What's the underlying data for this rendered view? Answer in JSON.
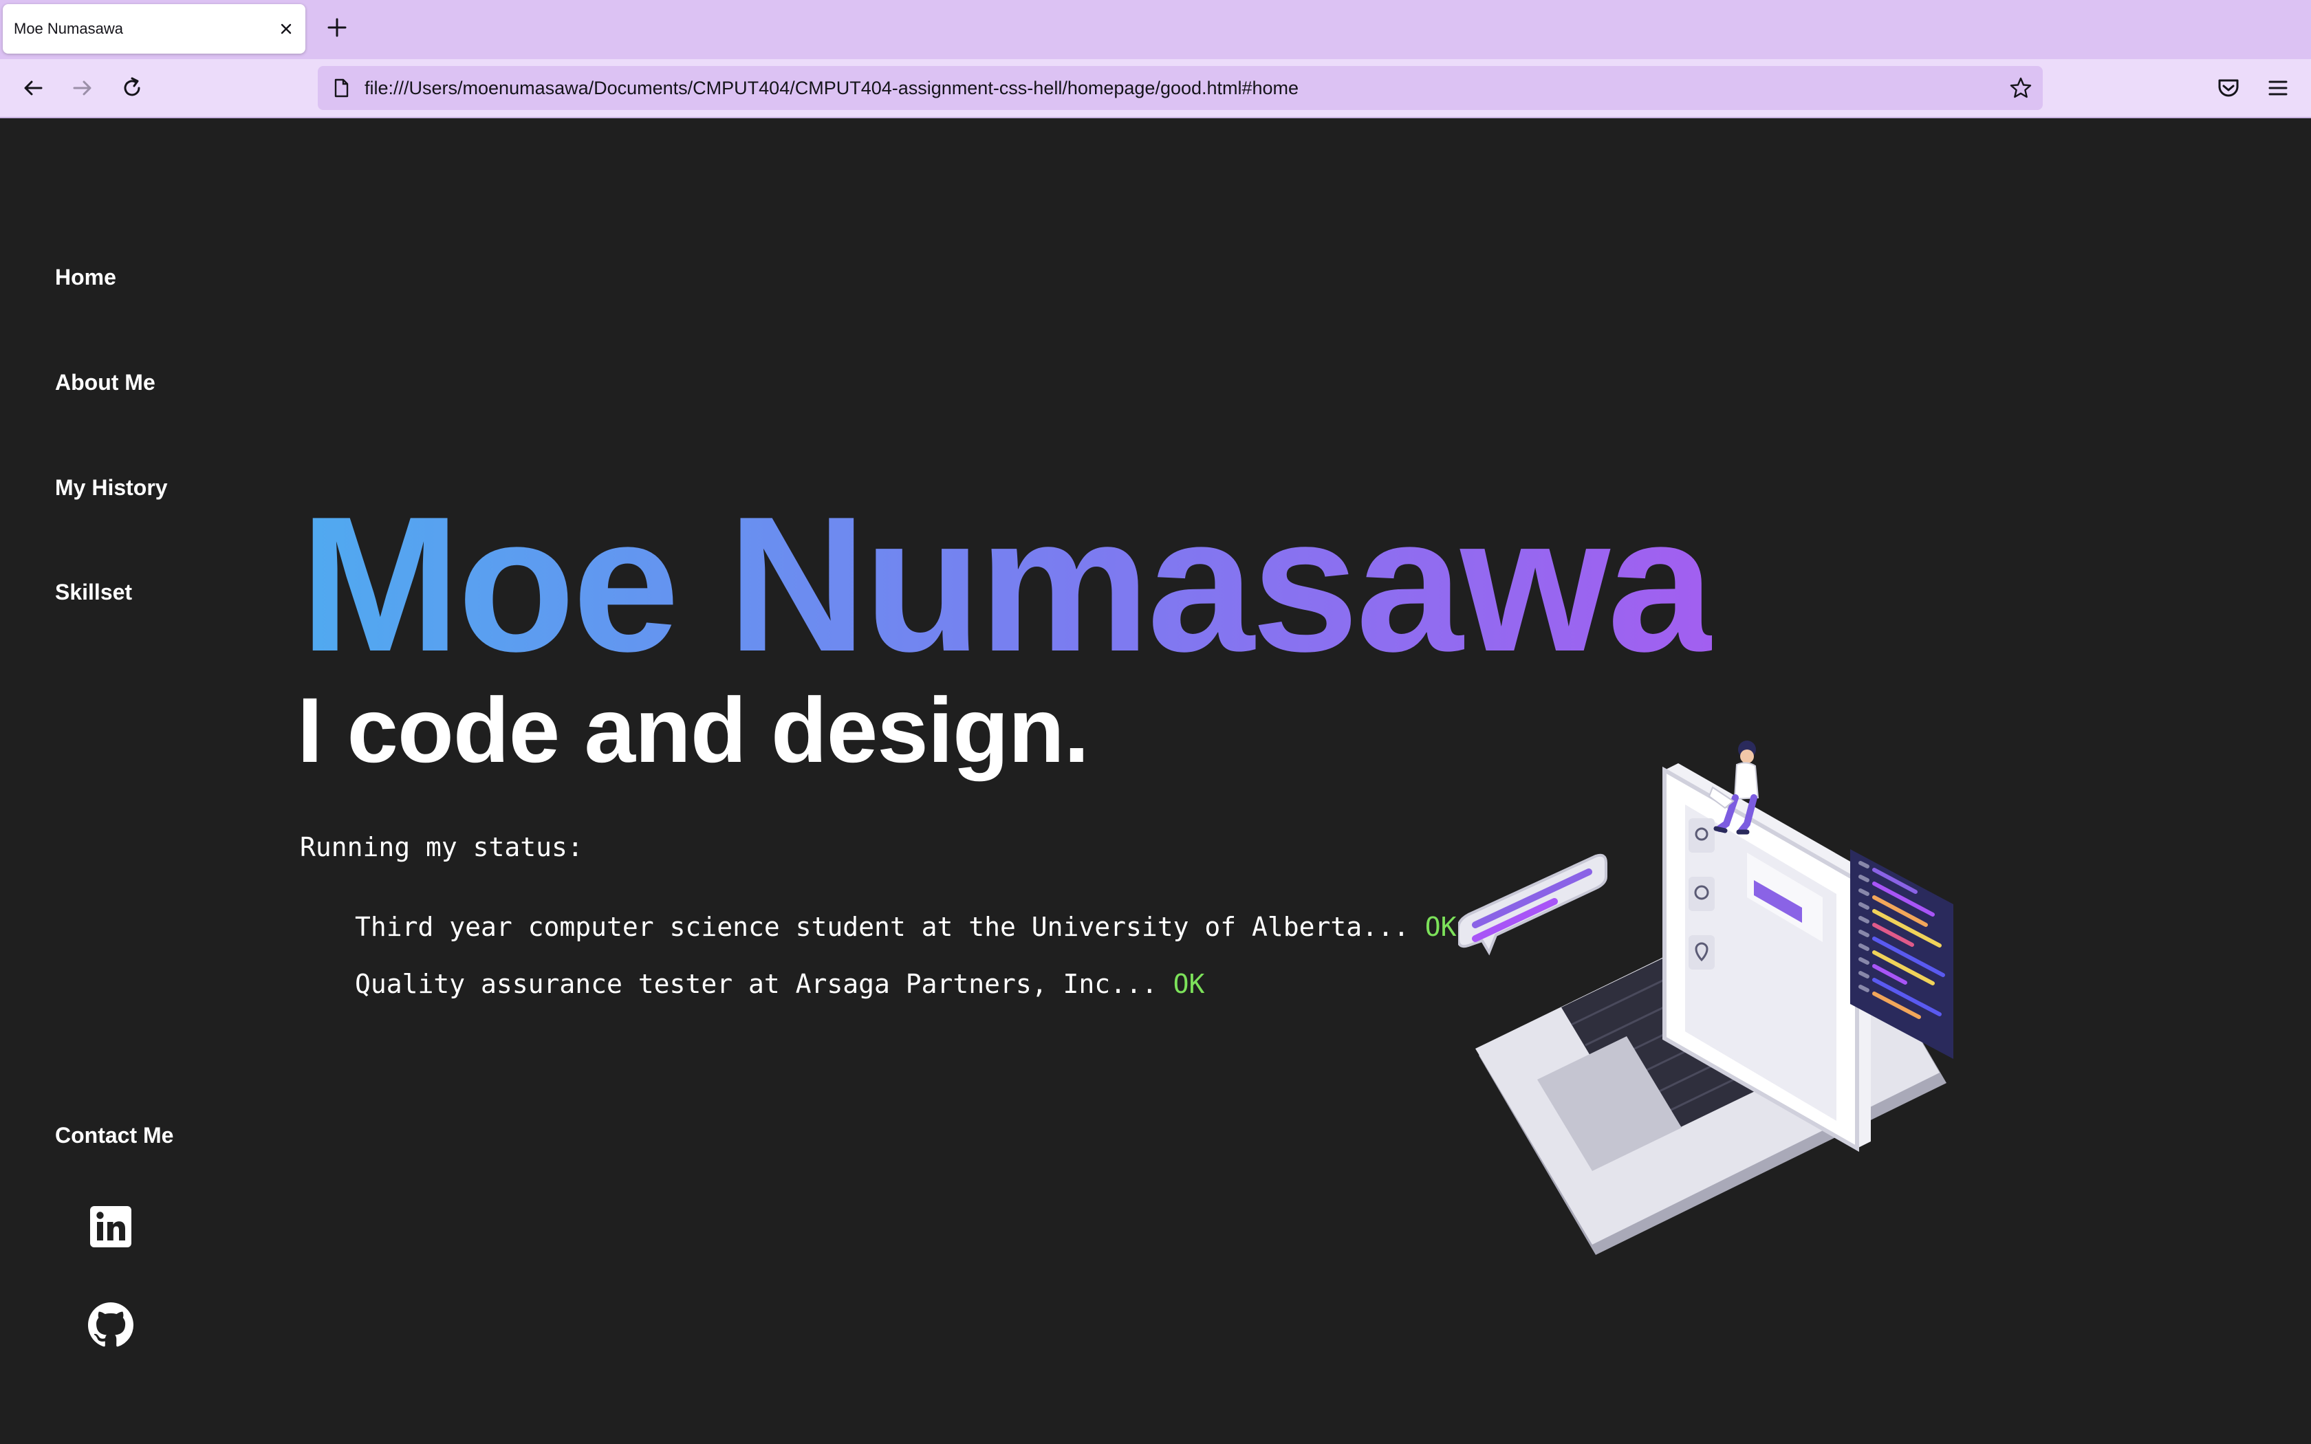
{
  "browser": {
    "tab_title": "Moe Numasawa",
    "url": "file:///Users/moenumasawa/Documents/CMPUT404/CMPUT404-assignment-css-hell/homepage/good.html#home"
  },
  "sidebar": {
    "nav": [
      {
        "label": "Home"
      },
      {
        "label": "About Me"
      },
      {
        "label": "My History"
      },
      {
        "label": "Skillset"
      }
    ],
    "contact_label": "Contact Me",
    "social": [
      "linkedin-icon",
      "github-icon"
    ]
  },
  "hero": {
    "name": "Moe Numasawa",
    "tagline": "I code and design.",
    "status_heading": "Running my status:",
    "status_lines": [
      {
        "text": "Third year computer science student at the University of Alberta... ",
        "result": "OK"
      },
      {
        "text": "Quality assurance tester at Arsaga Partners, Inc... ",
        "result": "OK"
      }
    ]
  },
  "colors": {
    "background": "#1f1f1f",
    "gradient_start": "#50aaf0",
    "gradient_end": "#a25ff0",
    "ok": "#7ce15a",
    "browser_tabbar": "#dcc2f3"
  }
}
